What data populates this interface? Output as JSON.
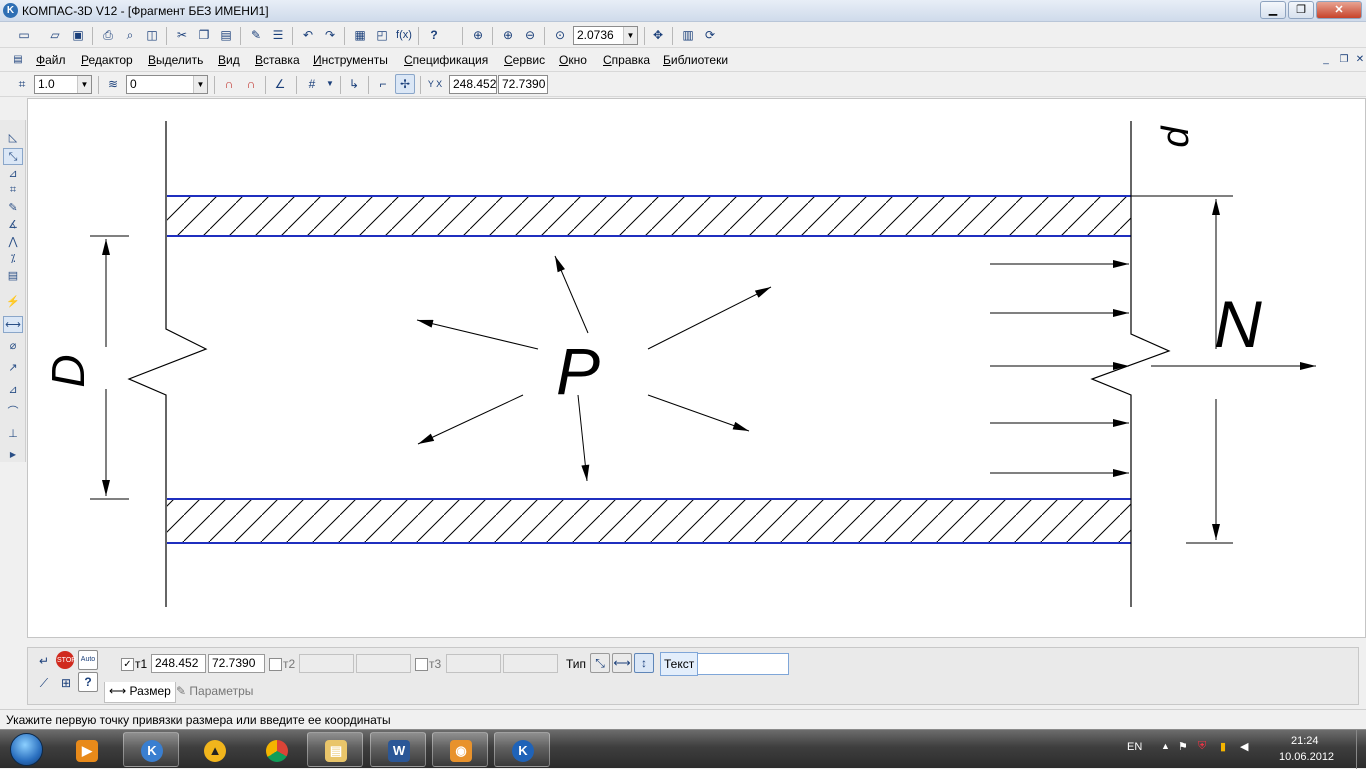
{
  "window": {
    "title": "КОМПАС-3D V12 - [Фрагмент БЕЗ ИМЕНИ1]",
    "logo": "K",
    "controls": {
      "minimize": "▁",
      "maximize": "❐",
      "close": "✕"
    }
  },
  "toolbar_main": {
    "icons": [
      "new-icon",
      "open-icon",
      "save-icon",
      "print-icon",
      "preview-icon",
      "export-icon",
      "cut-icon",
      "copy-icon",
      "paste-icon",
      "brush-icon",
      "properties-icon",
      "undo-icon",
      "redo-icon",
      "variables-icon",
      "manager-icon",
      "fx-icon",
      "help-pointer-icon",
      "zoom-window-icon",
      "zoom-in-icon",
      "zoom-out-icon",
      "zoom-scale-icon",
      "pan-icon",
      "refresh-icon",
      "rebuild-icon"
    ],
    "fx_label": "f(x)",
    "help_label": "?",
    "zoom_value": "2.0736"
  },
  "menubar": {
    "items": [
      {
        "u": "Ф",
        "rest": "айл"
      },
      {
        "u": "Р",
        "rest": "едактор"
      },
      {
        "u": "В",
        "rest": "ыделить"
      },
      {
        "u": "В",
        "rest": "ид"
      },
      {
        "u": "В",
        "rest": "ставка"
      },
      {
        "u": "И",
        "rest": "нструменты"
      },
      {
        "u": "С",
        "rest": "пецификация"
      },
      {
        "u": "С",
        "rest": "ервис"
      },
      {
        "u": "О",
        "rest": "кно"
      },
      {
        "u": "С",
        "rest": "правка"
      },
      {
        "u": "Б",
        "rest": "иблиотеки"
      }
    ]
  },
  "toolbar_current": {
    "step_value": "1.0",
    "layer_value": "0",
    "coord_x": "248.452",
    "coord_y": "72.7390",
    "coord_label": "Y X"
  },
  "left_tools": [
    "geometry-icon",
    "dimensions-icon",
    "symbols-icon",
    "editing-icon",
    "parametrization-icon",
    "measure-icon",
    "select-icon",
    "spec-icon",
    "reports-icon",
    "insert-icon",
    "linear-dimension-icon",
    "diameter-icon",
    "radial-icon",
    "angular-icon",
    "arc-icon",
    "leader-icon"
  ],
  "drawing": {
    "label_D": "D",
    "label_P": "P",
    "label_N": "N",
    "label_d": "d",
    "line_color": "#1f2fbf"
  },
  "propbar": {
    "t1_label": "т1",
    "t1_x": "248.452",
    "t1_y": "72.7390",
    "t2_label": "т2",
    "t3_label": "т3",
    "type_label": "Тип",
    "text_label": "Текст",
    "text_value": "",
    "tab_size": "Размер",
    "tab_params": "Параметры"
  },
  "status": {
    "hint": "Укажите первую точку привязки размера или введите ее координаты"
  },
  "taskbar": {
    "apps": [
      "media-player-icon",
      "kompas-old-icon",
      "archicad-icon",
      "chrome-icon",
      "explorer-icon",
      "word-icon",
      "photo-icon",
      "kompas-icon"
    ],
    "word_letter": "W",
    "tray": {
      "lang": "EN",
      "time": "21:24",
      "date": "10.06.2012"
    }
  }
}
